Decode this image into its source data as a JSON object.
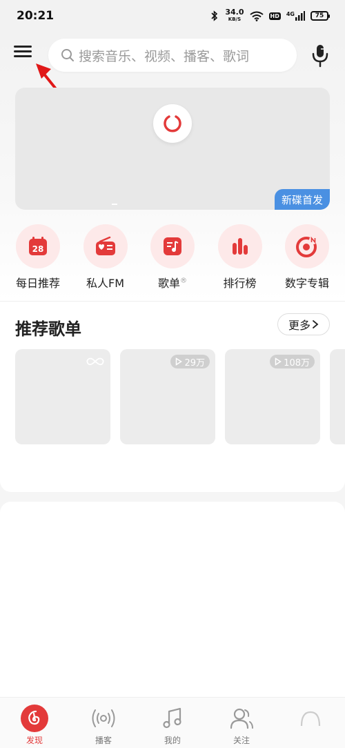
{
  "status_bar": {
    "time": "20:21",
    "speed_value": "34.0",
    "speed_unit": "KB/S",
    "hd": "HD",
    "network": "4G",
    "battery": "75"
  },
  "search": {
    "placeholder": "搜索音乐、视频、播客、歌词"
  },
  "banner": {
    "tag": "新碟首发"
  },
  "shortcuts": [
    {
      "label": "每日推荐",
      "icon": "calendar-icon",
      "day": "28"
    },
    {
      "label": "私人FM",
      "icon": "radio-icon"
    },
    {
      "label": "歌单",
      "icon": "playlist-icon",
      "mark": "®"
    },
    {
      "label": "排行榜",
      "icon": "chart-bars-icon"
    },
    {
      "label": "数字专辑",
      "icon": "album-icon"
    }
  ],
  "recommend": {
    "title": "推荐歌单",
    "more_label": "更多",
    "cards": [
      {
        "badge": ""
      },
      {
        "badge": "29万"
      },
      {
        "badge": "108万"
      }
    ]
  },
  "tabs": [
    {
      "label": "发现",
      "icon": "netease-music-icon",
      "active": true
    },
    {
      "label": "播客",
      "icon": "podcast-icon"
    },
    {
      "label": "我的",
      "icon": "music-note-icon"
    },
    {
      "label": "关注",
      "icon": "follow-people-icon"
    }
  ],
  "colors": {
    "accent": "#e33a3a",
    "banner_tag": "#4a90e2",
    "shortcut_bg": "#fde9e9"
  }
}
